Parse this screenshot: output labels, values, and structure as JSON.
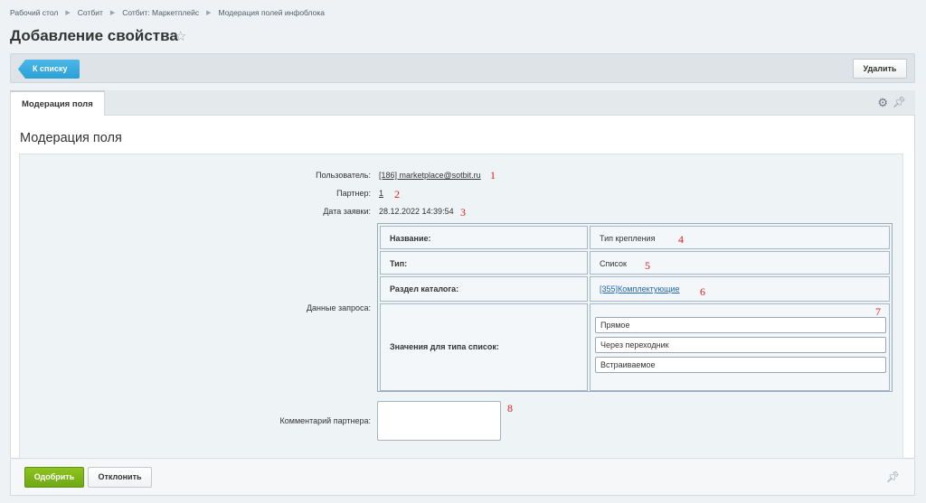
{
  "breadcrumb": [
    "Рабочий стол",
    "Сотбит",
    "Сотбит: Маркетплейс",
    "Модерация полей инфоблока"
  ],
  "page": {
    "title": "Добавление свойства"
  },
  "toolbar": {
    "back_label": "К списку",
    "delete_label": "Удалить"
  },
  "tabs": [
    {
      "label": "Модерация поля"
    }
  ],
  "panel": {
    "title": "Модерация поля"
  },
  "form": {
    "user_label": "Пользователь:",
    "user_value": "[186] marketplace@sotbit.ru",
    "partner_label": "Партнер:",
    "partner_value": "1",
    "date_label": "Дата заявки:",
    "date_value": "28.12.2022 14:39:54",
    "request_label": "Данные запроса:",
    "comment_label": "Комментарий партнера:",
    "comment_value": ""
  },
  "request": {
    "name_key": "Название:",
    "name_value": "Тип крепления",
    "type_key": "Тип:",
    "type_value": "Список",
    "section_key": "Раздел каталога:",
    "section_value": "[355]Комплектующие",
    "list_key": "Значения для типа список:",
    "list_values": [
      "Прямое",
      "Через переходник",
      "Встраиваемое"
    ]
  },
  "annotations": [
    "1",
    "2",
    "3",
    "4",
    "5",
    "6",
    "7",
    "8"
  ],
  "footer": {
    "approve_label": "Одобрить",
    "reject_label": "Отклонить"
  },
  "colors": {
    "accent_blue": "#2aa0d6",
    "approve_green": "#7ab51d",
    "annotation_red": "#e02020"
  }
}
